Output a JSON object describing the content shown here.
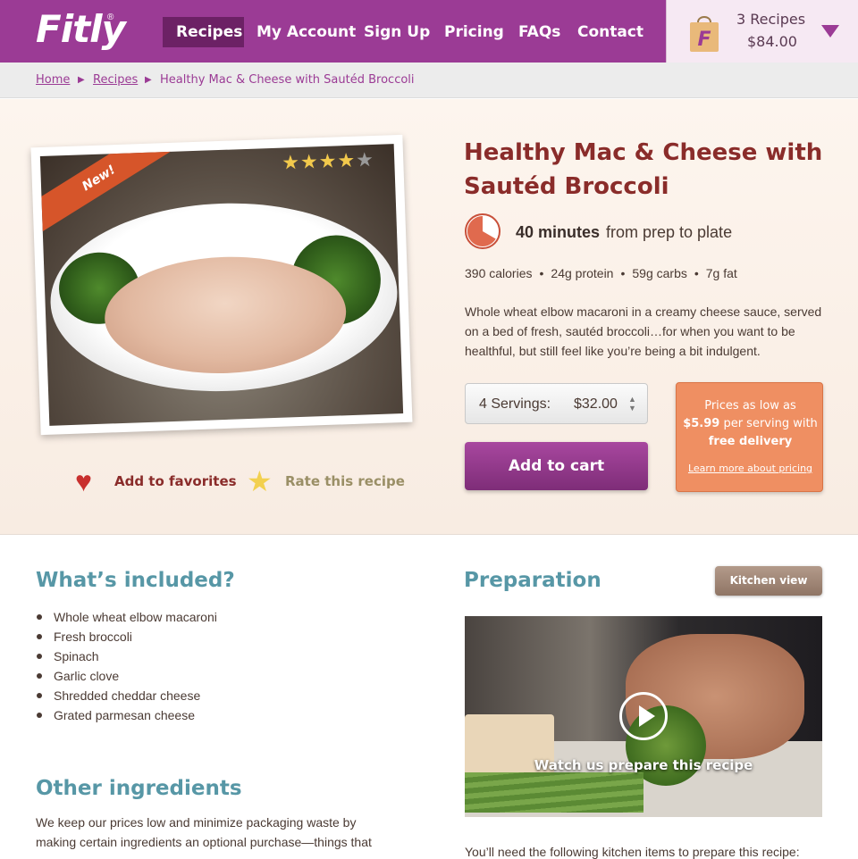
{
  "brand": {
    "logo": "Fitly",
    "logo_mark": "®"
  },
  "nav": {
    "items": [
      {
        "label": "Recipes",
        "active": true
      },
      {
        "label": "My Account"
      },
      {
        "label": "Sign Up"
      },
      {
        "label": "Pricing"
      },
      {
        "label": "FAQs"
      },
      {
        "label": "Contact"
      }
    ]
  },
  "cart": {
    "bag_letter": "F",
    "count": "3 Recipes",
    "total": "$84.00"
  },
  "breadcrumb": {
    "home": "Home",
    "recipes": "Recipes",
    "current": "Healthy Mac & Cheese with Sautéd Broccoli",
    "separator": "▶"
  },
  "recipe": {
    "badge": "New!",
    "rating": 4,
    "rating_max": 5,
    "title": "Healthy Mac & Cheese with Sautéd Broccoli",
    "time_strong": "40 minutes",
    "time_rest": "from prep to plate",
    "nutrition": [
      "390 calories",
      "24g protein",
      "59g carbs",
      "7g fat"
    ],
    "description": "Whole wheat elbow macaroni in a creamy cheese sauce, served on a bed of fresh, sautéd broccoli…for when you want to be healthful, but still feel like you’re being a bit indulgent.",
    "favorites_label": "Add to favorites",
    "rate_label": "Rate this recipe"
  },
  "servings": {
    "label": "4 Servings:",
    "price": "$32.00"
  },
  "add_to_cart": "Add to cart",
  "pricing_box": {
    "line1": "Prices as low as",
    "line2_strong": "$5.99",
    "line2_rest": " per serving with",
    "line3": "free delivery",
    "link": "Learn more about pricing"
  },
  "included": {
    "heading": "What’s included?",
    "items": [
      "Whole wheat elbow macaroni",
      "Fresh broccoli",
      "Spinach",
      "Garlic clove",
      "Shredded cheddar cheese",
      "Grated parmesan cheese"
    ]
  },
  "other": {
    "heading": "Other ingredients",
    "text": "We keep our prices low and minimize packaging waste by making certain ingredients an optional purchase—things that"
  },
  "preparation": {
    "heading": "Preparation",
    "kitchen_view": "Kitchen view",
    "video_caption": "Watch us prepare this recipe",
    "kitchen_note": "You’ll need the following kitchen items to prepare this recipe:"
  },
  "colors": {
    "brand_purple": "#9b3b95",
    "nav_active": "#6c2165",
    "title_red": "#8a2c2a",
    "heading_teal": "#5797a6",
    "pricing_orange": "#ef8f62"
  }
}
